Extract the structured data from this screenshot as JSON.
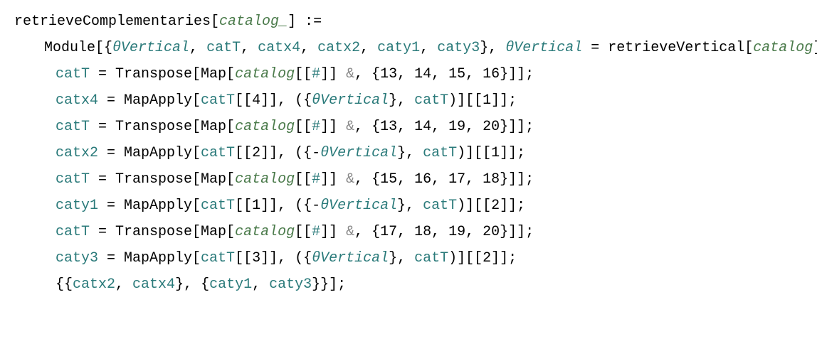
{
  "lines": {
    "l1": {
      "a": "retrieveComplementaries[",
      "b": "catalog_",
      "c": "] :="
    },
    "l2": {
      "a": "Module[{",
      "b": "θVertical",
      "c": ", ",
      "d": "catT",
      "e": ", ",
      "f": "catx4",
      "g": ", ",
      "h": "catx2",
      "i": ", ",
      "j": "caty1",
      "k": ", ",
      "l": "caty3",
      "m": "}, ",
      "n": "θVertical",
      "o": " = retrieveVertical[",
      "p": "catalog",
      "q": "];"
    },
    "l3": {
      "a": "catT",
      "b": " = Transpose[Map[",
      "c": "catalog",
      "d": "[[",
      "e": "#",
      "f": "]]",
      "g": " &",
      "h": ", {13, 14, 15, 16}]];"
    },
    "l4": {
      "a": "catx4",
      "b": " = MapApply[",
      "c": "catT",
      "d": "[[4]], ({",
      "e": "θVertical",
      "f": "}, ",
      "g": "catT",
      "h": ")][[1]];"
    },
    "l5": {
      "a": "catT",
      "b": " = Transpose[Map[",
      "c": "catalog",
      "d": "[[",
      "e": "#",
      "f": "]]",
      "g": " &",
      "h": ", {13, 14, 19, 20}]];"
    },
    "l6": {
      "a": "catx2",
      "b": " = MapApply[",
      "c": "catT",
      "d": "[[2]], ({-",
      "e": "θVertical",
      "f": "}, ",
      "g": "catT",
      "h": ")][[1]];"
    },
    "l7": {
      "a": "catT",
      "b": " = Transpose[Map[",
      "c": "catalog",
      "d": "[[",
      "e": "#",
      "f": "]]",
      "g": " &",
      "h": ", {15, 16, 17, 18}]];"
    },
    "l8": {
      "a": "caty1",
      "b": " = MapApply[",
      "c": "catT",
      "d": "[[1]], ({-",
      "e": "θVertical",
      "f": "}, ",
      "g": "catT",
      "h": ")][[2]];"
    },
    "l9": {
      "a": "catT",
      "b": " = Transpose[Map[",
      "c": "catalog",
      "d": "[[",
      "e": "#",
      "f": "]]",
      "g": " &",
      "h": ", {17, 18, 19, 20}]];"
    },
    "l10": {
      "a": "caty3",
      "b": " = MapApply[",
      "c": "catT",
      "d": "[[3]], ({",
      "e": "θVertical",
      "f": "}, ",
      "g": "catT",
      "h": ")][[2]];"
    },
    "l11": {
      "a": "{{",
      "b": "catx2",
      "c": ", ",
      "d": "catx4",
      "e": "}, {",
      "f": "caty1",
      "g": ", ",
      "h": "caty3",
      "i": "}}];"
    }
  }
}
